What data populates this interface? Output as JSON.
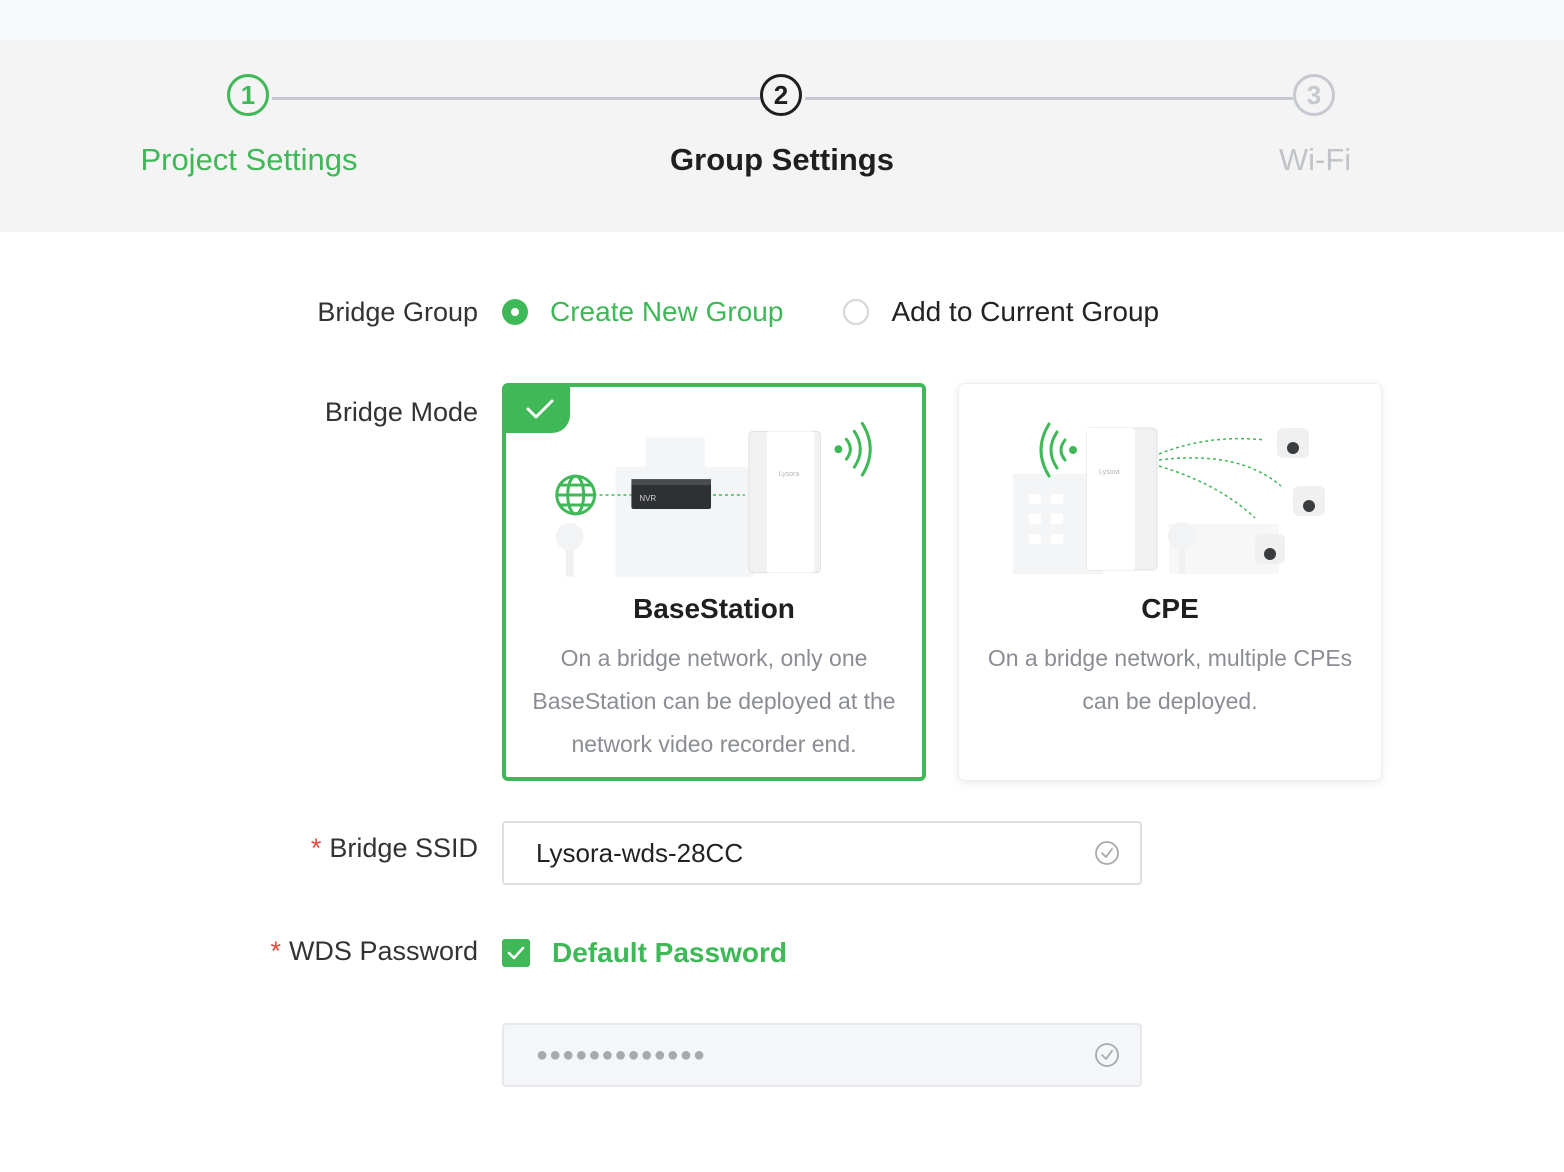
{
  "stepper": {
    "steps": [
      {
        "number": "1",
        "label": "Project Settings",
        "state": "done"
      },
      {
        "number": "2",
        "label": "Group Settings",
        "state": "active"
      },
      {
        "number": "3",
        "label": "Wi-Fi",
        "state": "todo"
      }
    ]
  },
  "form": {
    "bridge_group": {
      "label": "Bridge Group",
      "options": [
        {
          "label": "Create New Group",
          "selected": true
        },
        {
          "label": "Add to Current Group",
          "selected": false
        }
      ]
    },
    "bridge_mode": {
      "label": "Bridge Mode",
      "cards": [
        {
          "title": "BaseStation",
          "desc_lines": [
            "On a bridge network, only one",
            "BaseStation can be deployed at the",
            "network video recorder end."
          ],
          "selected": true,
          "device_brand": "Lysora",
          "recorder_label": "NVR"
        },
        {
          "title": "CPE",
          "desc_lines": [
            "On a bridge network, multiple CPEs",
            "can be deployed."
          ],
          "selected": false,
          "device_brand": "Lysora"
        }
      ]
    },
    "bridge_ssid": {
      "required_mark": "*",
      "label": "Bridge SSID",
      "value": "Lysora-wds-28CC"
    },
    "wds_password": {
      "required_mark": "*",
      "label": "WDS Password",
      "checkbox_label": "Default Password",
      "checked": true,
      "masked_value": "●●●●●●●●●●●●●"
    }
  },
  "icons": {
    "step_done_icon": "circle-number",
    "selected_badge": "check-icon",
    "input_valid": "check-circle-icon"
  },
  "colors": {
    "accent": "#3fb857",
    "required": "#e5483c",
    "muted": "#8a8d93"
  }
}
